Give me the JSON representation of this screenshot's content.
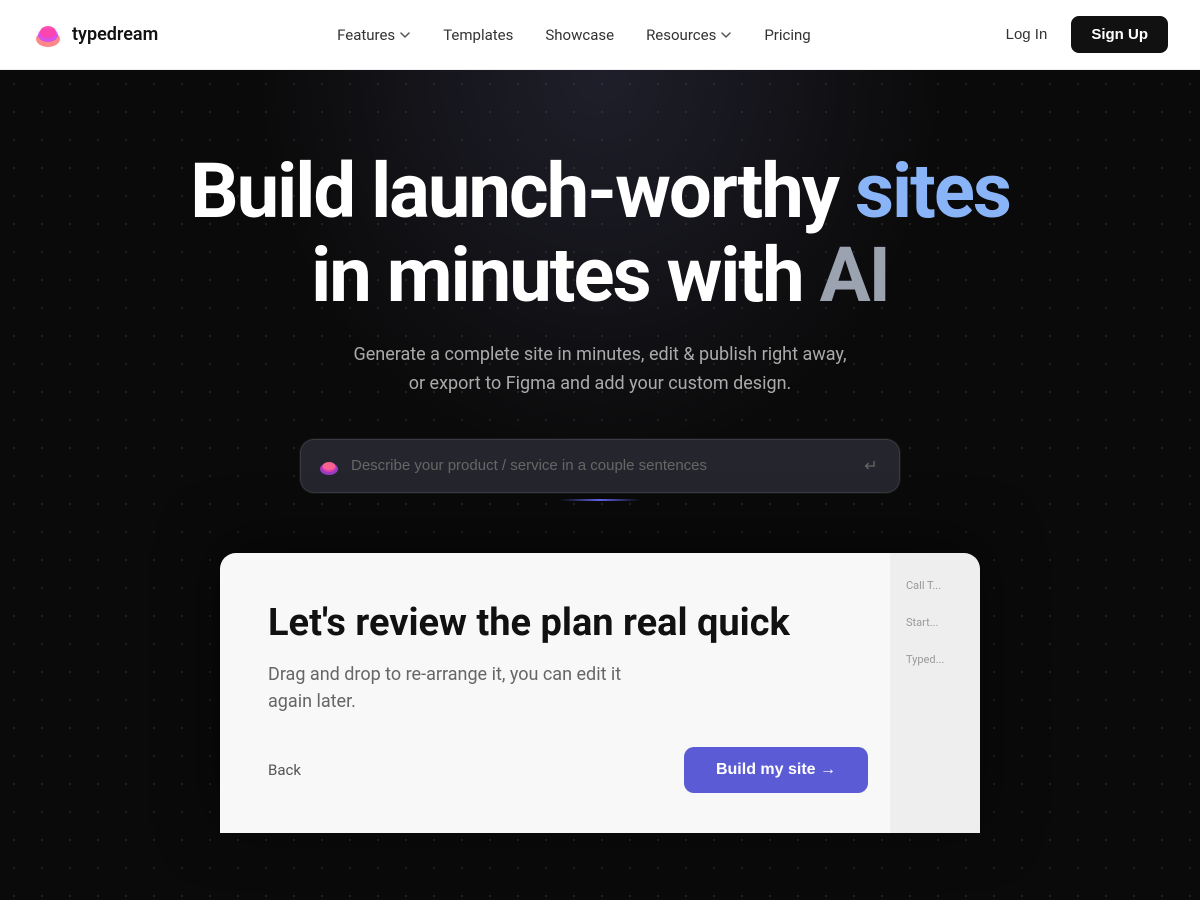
{
  "nav": {
    "logo_text": "typedream",
    "features_label": "Features",
    "templates_label": "Templates",
    "showcase_label": "Showcase",
    "resources_label": "Resources",
    "pricing_label": "Pricing",
    "login_label": "Log In",
    "signup_label": "Sign Up"
  },
  "hero": {
    "title_part1": "Build launch-worthy",
    "title_sites": "sites",
    "title_part2": "in minutes with",
    "title_ai": "AI",
    "subtitle_line1": "Generate a complete site in minutes, edit & publish right away,",
    "subtitle_line2": "or export to Figma and add your custom design.",
    "input_placeholder": "Describe your product / service in a couple sentences"
  },
  "preview": {
    "title": "Let's review the plan real quick",
    "subtitle_line1": "Drag and drop to re-arrange it, you can edit it",
    "subtitle_line2": "again later.",
    "back_label": "Back",
    "build_label": "Build my site →",
    "sidebar_items": [
      "Call T...",
      "Start...",
      "Typed..."
    ]
  },
  "icons": {
    "cloud_icon": "☁",
    "enter_icon": "↵",
    "chevron_down": "⌄"
  }
}
